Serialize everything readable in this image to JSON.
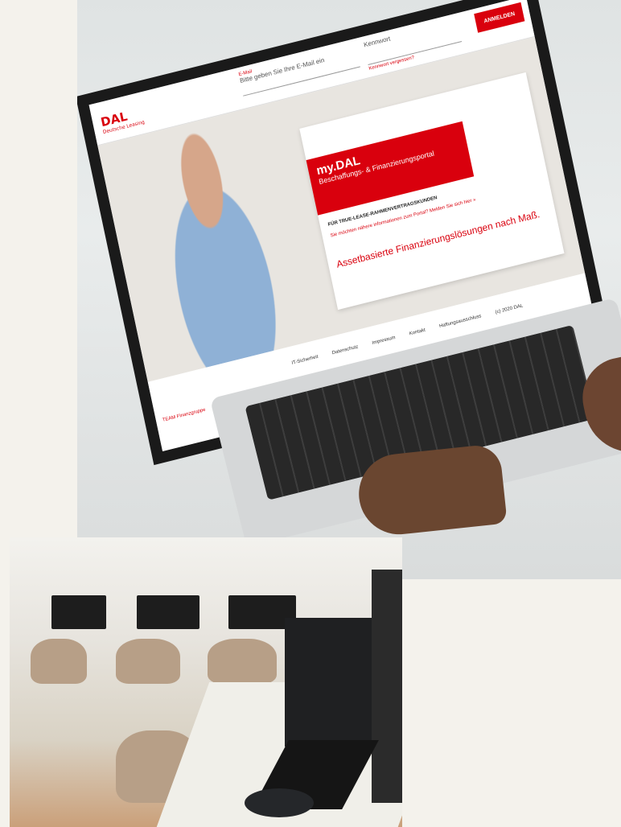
{
  "site": {
    "logo_text": "DAL",
    "logo_subtext": "Deutsche Leasing",
    "email_label": "E-Mail",
    "email_placeholder": "Bitte geben Sie Ihre E-Mail ein",
    "password_placeholder": "Kennwort",
    "forgot_link": "Kennwort vergessen?",
    "login_button": "ANMELDEN",
    "card_title": "my.DAL",
    "card_subtitle": "Beschaffungs- & Finanzierungsportal",
    "card_kicker": "FÜR TRUE-LEASE-RAHMENVERTRAGSKUNDEN",
    "card_link": "Sie möchten nähere informationen zum Portal? Melden Sie sich hier »",
    "card_tagline": "Assetbasierte Finanzierungslösungen nach Maß.",
    "footer_links": [
      "IT-Sicherheit",
      "Datenschutz",
      "Impressum",
      "Kontakt",
      "Haftungsausschluss"
    ],
    "copyright": "(c) 2020 DAL",
    "sponsor_text": "Finanzgruppe",
    "team_label": "TEAM"
  },
  "colors": {
    "brand_red": "#d9000d",
    "background": "#f4f2ec"
  }
}
